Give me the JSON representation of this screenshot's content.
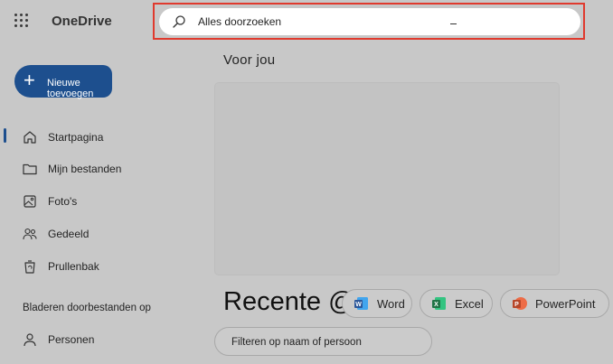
{
  "app": {
    "name": "OneDrive"
  },
  "search": {
    "placeholder": "Alles doorzoeken"
  },
  "new_button": {
    "label": "Nieuwe toevoegen"
  },
  "nav": {
    "items": [
      {
        "label": "Startpagina",
        "icon": "home-icon",
        "active": true
      },
      {
        "label": "Mijn bestanden",
        "icon": "folder-icon"
      },
      {
        "label": "Foto's",
        "icon": "image-icon"
      },
      {
        "label": "Gedeeld",
        "icon": "people-icon"
      },
      {
        "label": "Prullenbak",
        "icon": "recycle-bin-icon"
      }
    ],
    "browse_section": {
      "label": "Bladeren doorbestanden op"
    },
    "browse_items": [
      {
        "label": "Personen",
        "icon": "person-icon"
      }
    ]
  },
  "main": {
    "for_you_title": "Voor jou",
    "recent_title": "Recente @",
    "filter_chips": [
      {
        "label": "Word",
        "icon": "word-icon",
        "color": "#2b579a"
      },
      {
        "label": "Excel",
        "icon": "excel-icon",
        "color": "#217346"
      },
      {
        "label": "PowerPoint",
        "icon": "powerpoint-icon",
        "color": "#b7472a"
      }
    ],
    "filter_input": {
      "placeholder": "Filteren op naam of persoon"
    }
  },
  "colors": {
    "accent": "#1d4f8e",
    "highlight_outline": "#e03a2e",
    "overlay_background": "#c8c8c8"
  }
}
